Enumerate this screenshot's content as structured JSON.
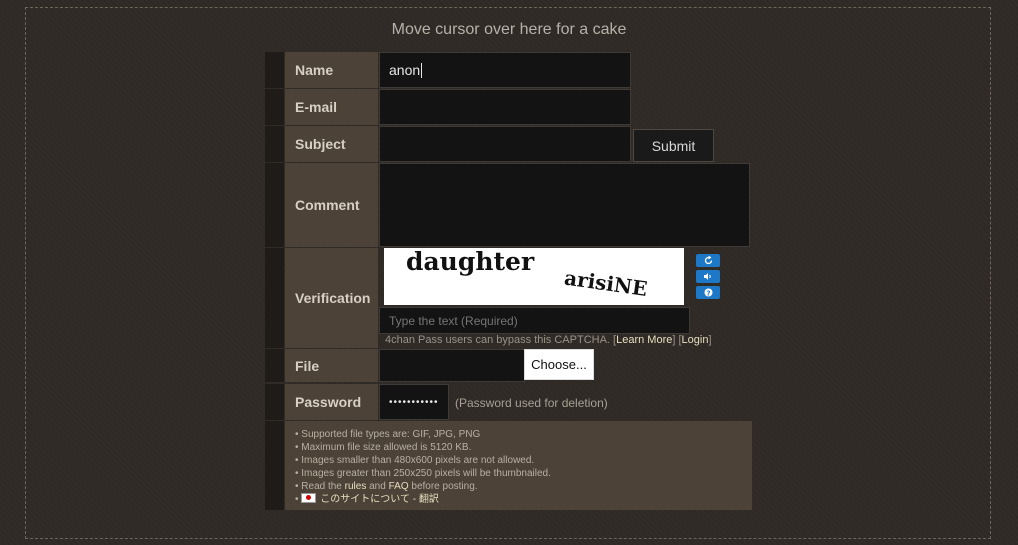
{
  "header": {
    "cake_text": "Move cursor over here for a cake"
  },
  "form": {
    "name_label": "Name",
    "name_value": "anon",
    "email_label": "E-mail",
    "subject_label": "Subject",
    "submit_label": "Submit",
    "comment_label": "Comment",
    "verification_label": "Verification",
    "captcha_words": [
      "daughter",
      "arisiNE"
    ],
    "captcha_placeholder": "Type the text (Required)",
    "captcha_icons": [
      "refresh-icon",
      "audio-icon",
      "help-icon"
    ],
    "pass_note_prefix": "4chan Pass users can bypass this CAPTCHA. [",
    "learn_more": "Learn More",
    "pass_note_mid": "] [",
    "login": "Login",
    "pass_note_suffix": "]",
    "file_label": "File",
    "choose_label": "Choose...",
    "password_label": "Password",
    "password_value": "•••••••••••",
    "password_note": "(Password used for deletion)"
  },
  "rules": {
    "line1": "• Supported file types are: GIF, JPG, PNG",
    "line2": "• Maximum file size allowed is 5120 KB.",
    "line3": "• Images smaller than 480x600 pixels are not allowed.",
    "line4": "• Images greater than 250x250 pixels will be thumbnailed.",
    "line5_prefix": "• Read the ",
    "rules_link": "rules",
    "line5_mid": " and ",
    "faq_link": "FAQ",
    "line5_suffix": " before posting.",
    "line6_prefix": "• ",
    "jp_link": "このサイトについて - 翻訳"
  },
  "colors": {
    "accent_link": "#e9dfbf",
    "label_bg": "#4c4237",
    "field_bg": "#131313",
    "captcha_button": "#1e78c8"
  }
}
